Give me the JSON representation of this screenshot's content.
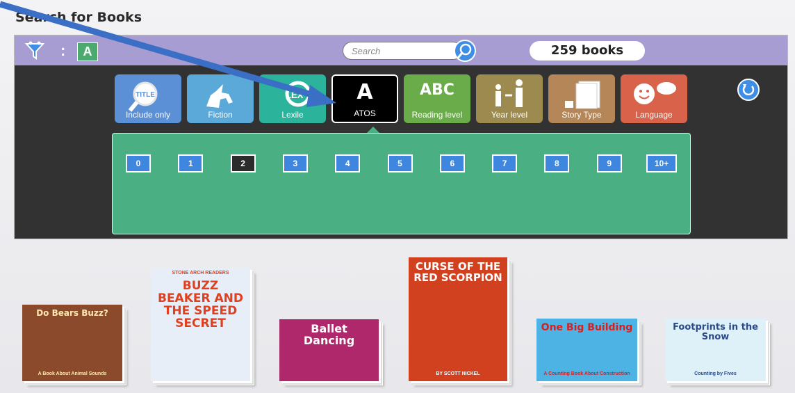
{
  "page": {
    "title": "Search for Books"
  },
  "toolbar": {
    "level_badge": "A",
    "search_placeholder": "Search",
    "book_count": "259 books"
  },
  "filters": [
    {
      "label": "Include only",
      "color": "#5b8fd6",
      "icon": "title-magnifier-icon"
    },
    {
      "label": "Fiction",
      "color": "#5aa9d9",
      "icon": "unicorn-icon"
    },
    {
      "label": "Lexile",
      "color": "#2bb39c",
      "icon": "lexile-logo-icon"
    },
    {
      "label": "ATOS",
      "color": "#000000",
      "icon": "letter-a-icon",
      "glyph": "A"
    },
    {
      "label": "Reading level",
      "color": "#6aab4a",
      "icon": "abc-blocks-icon",
      "glyph": "ABC"
    },
    {
      "label": "Year level",
      "color": "#9c8a4e",
      "icon": "people-icon"
    },
    {
      "label": "Story Type",
      "color": "#b48658",
      "icon": "book-stack-icon"
    },
    {
      "label": "Language",
      "color": "#d9624a",
      "icon": "speech-bubble-icon"
    }
  ],
  "levels": [
    "0",
    "1",
    "2",
    "3",
    "4",
    "5",
    "6",
    "7",
    "8",
    "9",
    "10+"
  ],
  "selected_level": "2",
  "books": [
    {
      "title": "Do Bears Buzz?",
      "subtitle": "A Book About Animal Sounds",
      "bg": "#8a4a2b",
      "title_color": "#ffe9b0"
    },
    {
      "title": "BUZZ BEAKER AND THE SPEED SECRET",
      "subtitle": "STONE ARCH READERS",
      "bg": "#e7eef8",
      "title_color": "#e0401f"
    },
    {
      "title": "Ballet Dancing",
      "subtitle": "",
      "bg": "#b0286c",
      "title_color": "#ffffff"
    },
    {
      "title": "CURSE OF THE RED SCORPION",
      "subtitle": "BY SCOTT NICKEL",
      "bg": "#d1401f",
      "title_color": "#ffffff"
    },
    {
      "title": "One Big Building",
      "subtitle": "A Counting Book About Construction",
      "bg": "#4cb3e4",
      "title_color": "#d92020"
    },
    {
      "title": "Footprints in the Snow",
      "subtitle": "Counting by Fives",
      "bg": "#dff1f8",
      "title_color": "#2a4a8a"
    }
  ],
  "colors": {
    "header": "#a89dd2",
    "panel": "#323232",
    "levels_area": "#4aaf82",
    "level_button": "#3e86de",
    "accent_arrow": "#3b6fc6"
  }
}
